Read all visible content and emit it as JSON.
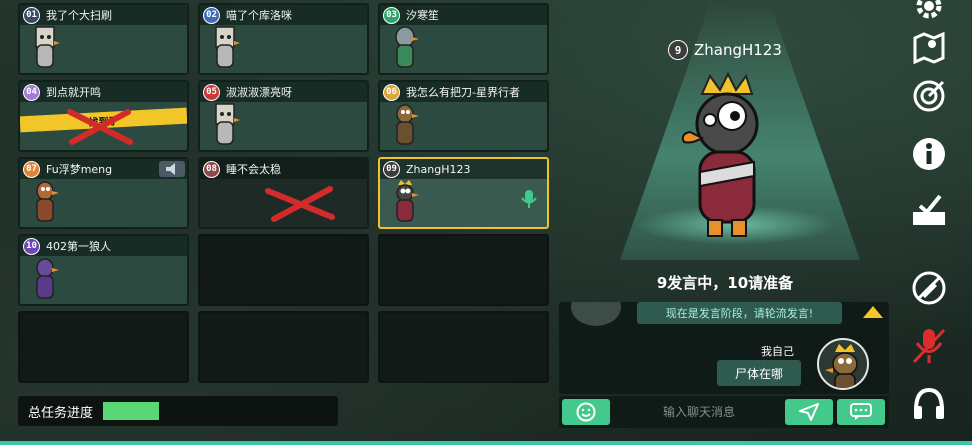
{
  "players": [
    {
      "num": "01",
      "name": "我了个大扫刷",
      "color": "#3b4a66",
      "state": "alive"
    },
    {
      "num": "02",
      "name": "喵了个库洛咪",
      "color": "#3d6fb8",
      "state": "alive"
    },
    {
      "num": "03",
      "name": "汐寒笙",
      "color": "#2fa56b",
      "state": "alive"
    },
    {
      "num": "04",
      "name": "到点就开鸣",
      "color": "#a67bd6",
      "state": "found",
      "tape": "找到了"
    },
    {
      "num": "05",
      "name": "淑淑淑漂亮呀",
      "color": "#c93a3a",
      "state": "alive"
    },
    {
      "num": "06",
      "name": "我怎么有把刀-星界行者",
      "color": "#d9a63a",
      "state": "alive"
    },
    {
      "num": "07",
      "name": "Fu浮梦meng",
      "color": "#e0833a",
      "state": "alive"
    },
    {
      "num": "08",
      "name": "睡不会太稳",
      "color": "#8a4a4a",
      "state": "dead"
    },
    {
      "num": "09",
      "name": "ZhangH123",
      "color": "#3c3c3c",
      "state": "speaking"
    },
    {
      "num": "10",
      "name": "402第一狼人",
      "color": "#6a4ab8",
      "state": "alive"
    }
  ],
  "progress": {
    "label": "总任务进度",
    "value": 0.28
  },
  "speaker": {
    "num": "9",
    "name": "ZhangH123"
  },
  "status_text": "9发言中，10请准备",
  "chat": {
    "system_message": "现在是发言阶段，请轮流发言!",
    "my_label": "我自己",
    "my_message": "尸体在哪",
    "input_placeholder": "输入聊天消息"
  },
  "side_icons": [
    "gear-icon",
    "map-icon",
    "target-icon",
    "info-icon",
    "vote-box-icon",
    "no-skill-icon",
    "mic-muted-icon",
    "headphones-icon"
  ],
  "colors": {
    "accent": "#43c98b",
    "highlight": "#f0c32c",
    "progress": "#58d774"
  }
}
